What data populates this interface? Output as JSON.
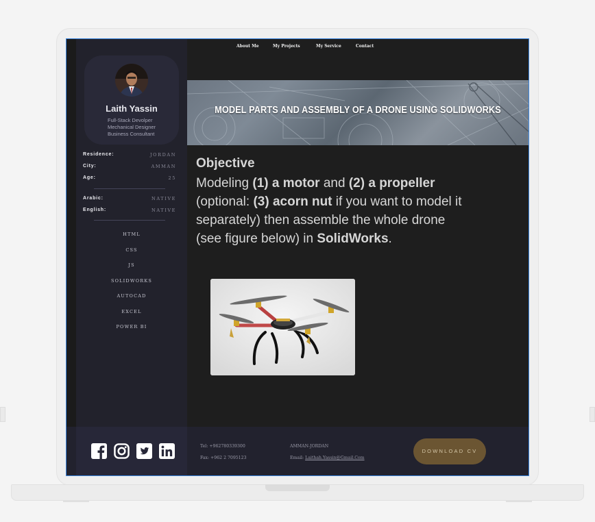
{
  "nav": {
    "items": [
      "About Me",
      "My Projects",
      "My Service",
      "Contact"
    ]
  },
  "profile": {
    "name": "Laith Yassin",
    "roles": [
      "Full-Stack Devolper",
      "Mechanical Designer",
      "Business Consultant"
    ]
  },
  "info": [
    {
      "label": "Residence:",
      "value": "JORDAN"
    },
    {
      "label": "City:",
      "value": "AMMAN"
    },
    {
      "label": "Age:",
      "value": "25"
    }
  ],
  "languages": [
    {
      "label": "Arabic:",
      "value": "NATIVE"
    },
    {
      "label": "English:",
      "value": "NATIVE"
    }
  ],
  "skills": [
    "HTML",
    "CSS",
    "JS",
    "SOLIDWORKS",
    "AUTOCAD",
    "EXCEL",
    "POWER BI"
  ],
  "banner": {
    "title": "MODEL PARTS AND ASSEMBLY OF A DRONE USING SOLIDWORKS"
  },
  "objective": {
    "heading": "Objective",
    "body_parts": [
      "Modeling ",
      "(1) a motor",
      " and ",
      "(2) a propeller",
      " (optional: ",
      "(3) acorn nut",
      " if you want to model it separately) then assemble the whole drone (see figure below) in ",
      "SolidWorks",
      "."
    ]
  },
  "footer": {
    "tel": "Tel: +962780339300",
    "fax": "Fax: +962 2 7095123",
    "location": "AMMAN-JORDAN",
    "email_label": "Email: ",
    "email": "Laithah.Yassin@Gmail.Com",
    "cv_button": "DOWNLOAD CV"
  },
  "icons": [
    "facebook-icon",
    "instagram-icon",
    "twitter-icon",
    "linkedin-icon"
  ],
  "colors": {
    "accent_border": "#3b86e0",
    "sidebar_bg": "#22222c",
    "content_bg": "#1e1e1e",
    "cv_button_bg": "#6b5532"
  }
}
